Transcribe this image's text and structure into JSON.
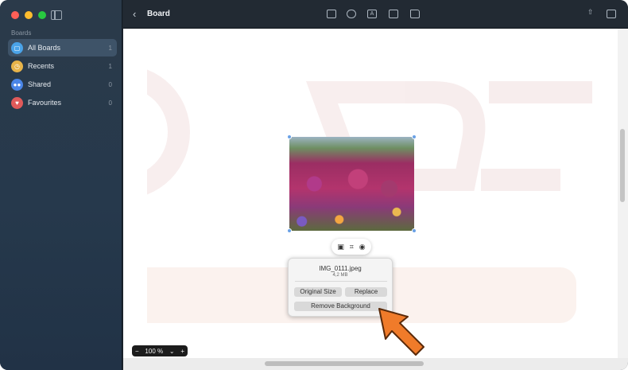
{
  "sidebar": {
    "section_label": "Boards",
    "items": [
      {
        "label": "All Boards",
        "count": "1",
        "icon": "boards-icon",
        "color": "#4aa3e8",
        "active": true
      },
      {
        "label": "Recents",
        "count": "1",
        "icon": "clock-icon",
        "color": "#e8b44a",
        "active": false
      },
      {
        "label": "Shared",
        "count": "0",
        "icon": "people-icon",
        "color": "#4a86e8",
        "active": false
      },
      {
        "label": "Favourites",
        "count": "0",
        "icon": "heart-icon",
        "color": "#e05a5a",
        "active": false
      }
    ]
  },
  "toolbar": {
    "title": "Board",
    "tools": [
      "note-icon",
      "shapes-icon",
      "text-icon",
      "media-icon",
      "folder-icon"
    ],
    "right": [
      "share-icon",
      "compose-icon"
    ]
  },
  "image": {
    "filename": "IMG_0111.jpeg",
    "size": "4,2 MB"
  },
  "popover": {
    "original_size": "Original Size",
    "replace": "Replace",
    "remove_background": "Remove Background"
  },
  "zoom": {
    "minus": "−",
    "value": "100 %",
    "caret": "⌄",
    "plus": "+"
  },
  "colors": {
    "accent": "#6aa1e6",
    "arrow": "#f07b2a",
    "sidebar_active": "#3e5368"
  }
}
